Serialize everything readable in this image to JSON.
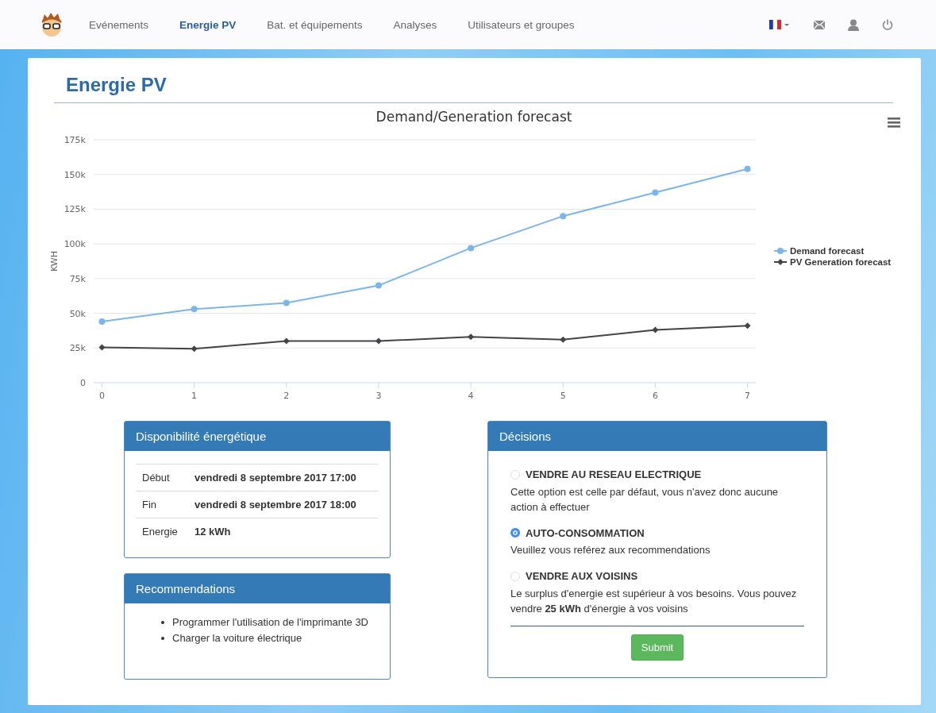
{
  "nav": {
    "items": [
      {
        "label": "Evénements",
        "selected": false
      },
      {
        "label": "Energie PV",
        "selected": true
      },
      {
        "label": "Bat. et équipements",
        "selected": false
      },
      {
        "label": "Analyses",
        "selected": false
      },
      {
        "label": "Utilisateurs et groupes",
        "selected": false
      }
    ]
  },
  "page_title": "Energie PV",
  "chart_data": {
    "type": "line",
    "title": "Demand/Generation forecast",
    "ylabel": "KWH",
    "x": [
      0,
      1,
      2,
      3,
      4,
      5,
      6,
      7
    ],
    "xticks": [
      0,
      1,
      2,
      3,
      4,
      5,
      6,
      7
    ],
    "xlim": [
      -0.09,
      7.09
    ],
    "ylim": [
      0,
      175000
    ],
    "grid": true,
    "legend": true,
    "yticks": [
      {
        "value": 0,
        "label": "0"
      },
      {
        "value": 25000,
        "label": "25k"
      },
      {
        "value": 50000,
        "label": "50k"
      },
      {
        "value": 75000,
        "label": "75k"
      },
      {
        "value": 100000,
        "label": "100k"
      },
      {
        "value": 125000,
        "label": "125k"
      },
      {
        "value": 150000,
        "label": "150k"
      },
      {
        "value": 175000,
        "label": "175k"
      }
    ],
    "series": [
      {
        "name": "Demand forecast",
        "color": "#7cb5ec",
        "marker": "circle",
        "values": [
          44000,
          53000,
          57500,
          70000,
          97000,
          120000,
          137000,
          154000
        ]
      },
      {
        "name": "PV Generation forecast",
        "color": "#434348",
        "marker": "diamond",
        "values": [
          25500,
          24500,
          30000,
          30000,
          33000,
          31000,
          38000,
          41000
        ]
      }
    ]
  },
  "availability": {
    "title": "Disponibilité énergétique",
    "rows": [
      {
        "label": "Début",
        "value": "vendredi 8 septembre 2017 17:00"
      },
      {
        "label": "Fin",
        "value": "vendredi 8 septembre 2017 18:00"
      },
      {
        "label": "Energie",
        "value": "12 kWh"
      }
    ]
  },
  "recommendations": {
    "title": "Recommendations",
    "items": [
      "Programmer l'utilisation de l'imprimante 3D",
      "Charger la voiture électrique"
    ]
  },
  "decisions": {
    "title": "Décisions",
    "options": [
      {
        "label": "VENDRE AU RESEAU ELECTRIQUE",
        "selected": false,
        "description": "Cette option est celle par défaut, vous n'avez donc aucune action à effectuer"
      },
      {
        "label": "AUTO-CONSOMMATION",
        "selected": true,
        "description": "Veuillez vous reférez aux recommendations"
      },
      {
        "label": "VENDRE AUX VOISINS",
        "selected": false,
        "description": "Le surplus d'energie est supérieur à vos besoins. Vous pouvez vendre **25 kWh** d'énergie à vos voisins"
      }
    ],
    "submit": "Submit"
  }
}
